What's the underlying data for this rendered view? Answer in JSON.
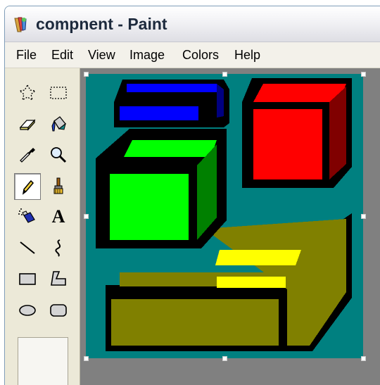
{
  "window": {
    "title": "compnent - Paint"
  },
  "menu": [
    "File",
    "Edit",
    "View",
    "Image",
    "Colors",
    "Help"
  ],
  "tools": [
    {
      "name": "free-form-select-icon"
    },
    {
      "name": "select-icon"
    },
    {
      "name": "eraser-icon"
    },
    {
      "name": "fill-bucket-icon"
    },
    {
      "name": "eyedropper-icon"
    },
    {
      "name": "magnifier-icon"
    },
    {
      "name": "pencil-icon",
      "selected": true
    },
    {
      "name": "brush-icon"
    },
    {
      "name": "airbrush-icon"
    },
    {
      "name": "text-icon",
      "glyph": "A"
    },
    {
      "name": "line-icon"
    },
    {
      "name": "curve-icon"
    },
    {
      "name": "rectangle-icon"
    },
    {
      "name": "polygon-icon"
    },
    {
      "name": "ellipse-icon"
    },
    {
      "name": "rounded-rectangle-icon"
    }
  ],
  "colors": {
    "canvas_background": "#008080",
    "outline": "#000000",
    "blue": "#0000ff",
    "red": "#ff0000",
    "dark_red": "#800000",
    "green": "#00ff00",
    "dark_green": "#008000",
    "olive": "#808000",
    "yellow": "#ffff00",
    "workspace": "#808080"
  }
}
